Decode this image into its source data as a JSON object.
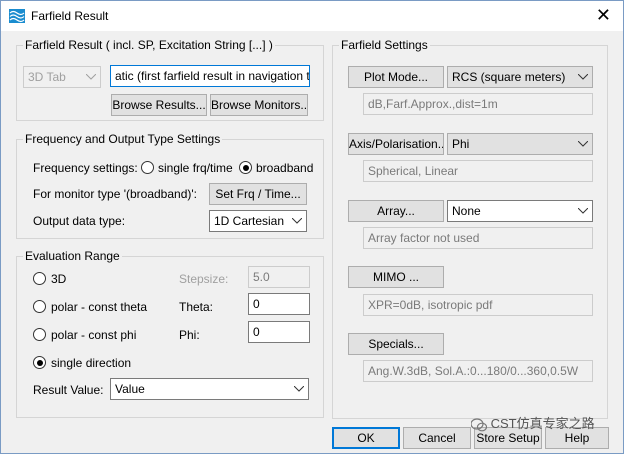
{
  "window": {
    "title": "Farfield Result",
    "close_glyph": "✕"
  },
  "farfield_result": {
    "legend": "Farfield Result ( incl. SP, Excitation String [...] )",
    "tab_combo": "3D Tab",
    "result_field": "atic (first farfield result in navigation tree)",
    "browse_results": "Browse Results...",
    "browse_monitors": "Browse Monitors..."
  },
  "freq_settings": {
    "legend": "Frequency and Output Type Settings",
    "frequency_label": "Frequency settings:",
    "single_frq": "single frq/time",
    "broadband": "broadband",
    "monitor_label": "For monitor type '(broadband)':",
    "set_frq_button": "Set Frq / Time...",
    "output_label": "Output data type:",
    "output_value": "1D Cartesian"
  },
  "eval_range": {
    "legend": "Evaluation Range",
    "opt_3d": "3D",
    "opt_theta": "polar - const theta",
    "opt_phi": "polar - const phi",
    "opt_single": "single direction",
    "stepsize_label": "Stepsize:",
    "stepsize_value": "5.0",
    "theta_label": "Theta:",
    "theta_value": "0",
    "phi_label": "Phi:",
    "phi_value": "0",
    "result_value_label": "Result Value:",
    "result_value": "Value"
  },
  "farfield_settings": {
    "legend": "Farfield Settings",
    "plot_mode_button": "Plot Mode...",
    "plot_mode_value": "RCS (square meters)",
    "plot_mode_info": "dB,Farf.Approx.,dist=1m",
    "axis_button": "Axis/Polarisation...",
    "axis_value": "Phi",
    "axis_info": "Spherical, Linear",
    "array_button": "Array...",
    "array_value": "None",
    "array_info": "Array factor not used",
    "mimo_button": "MIMO ...",
    "mimo_info": "XPR=0dB, isotropic pdf",
    "specials_button": "Specials...",
    "specials_info": "Ang.W.3dB, Sol.A.:0...180/0...360,0.5W"
  },
  "footer": {
    "ok": "OK",
    "cancel": "Cancel",
    "store_setup": "Store Setup",
    "help": "Help"
  },
  "watermark": "CST仿真专家之路",
  "colors": {
    "accent": "#0078d7",
    "icon": "#1a8ccf"
  }
}
